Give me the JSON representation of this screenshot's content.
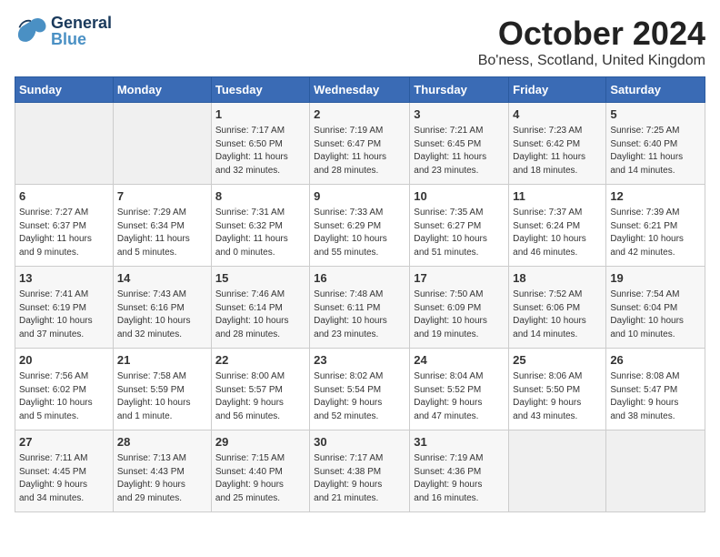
{
  "logo": {
    "general": "General",
    "blue": "Blue"
  },
  "title": "October 2024",
  "subtitle": "Bo'ness, Scotland, United Kingdom",
  "days_of_week": [
    "Sunday",
    "Monday",
    "Tuesday",
    "Wednesday",
    "Thursday",
    "Friday",
    "Saturday"
  ],
  "weeks": [
    [
      {
        "day": "",
        "info": ""
      },
      {
        "day": "",
        "info": ""
      },
      {
        "day": "1",
        "info": "Sunrise: 7:17 AM\nSunset: 6:50 PM\nDaylight: 11 hours\nand 32 minutes."
      },
      {
        "day": "2",
        "info": "Sunrise: 7:19 AM\nSunset: 6:47 PM\nDaylight: 11 hours\nand 28 minutes."
      },
      {
        "day": "3",
        "info": "Sunrise: 7:21 AM\nSunset: 6:45 PM\nDaylight: 11 hours\nand 23 minutes."
      },
      {
        "day": "4",
        "info": "Sunrise: 7:23 AM\nSunset: 6:42 PM\nDaylight: 11 hours\nand 18 minutes."
      },
      {
        "day": "5",
        "info": "Sunrise: 7:25 AM\nSunset: 6:40 PM\nDaylight: 11 hours\nand 14 minutes."
      }
    ],
    [
      {
        "day": "6",
        "info": "Sunrise: 7:27 AM\nSunset: 6:37 PM\nDaylight: 11 hours\nand 9 minutes."
      },
      {
        "day": "7",
        "info": "Sunrise: 7:29 AM\nSunset: 6:34 PM\nDaylight: 11 hours\nand 5 minutes."
      },
      {
        "day": "8",
        "info": "Sunrise: 7:31 AM\nSunset: 6:32 PM\nDaylight: 11 hours\nand 0 minutes."
      },
      {
        "day": "9",
        "info": "Sunrise: 7:33 AM\nSunset: 6:29 PM\nDaylight: 10 hours\nand 55 minutes."
      },
      {
        "day": "10",
        "info": "Sunrise: 7:35 AM\nSunset: 6:27 PM\nDaylight: 10 hours\nand 51 minutes."
      },
      {
        "day": "11",
        "info": "Sunrise: 7:37 AM\nSunset: 6:24 PM\nDaylight: 10 hours\nand 46 minutes."
      },
      {
        "day": "12",
        "info": "Sunrise: 7:39 AM\nSunset: 6:21 PM\nDaylight: 10 hours\nand 42 minutes."
      }
    ],
    [
      {
        "day": "13",
        "info": "Sunrise: 7:41 AM\nSunset: 6:19 PM\nDaylight: 10 hours\nand 37 minutes."
      },
      {
        "day": "14",
        "info": "Sunrise: 7:43 AM\nSunset: 6:16 PM\nDaylight: 10 hours\nand 32 minutes."
      },
      {
        "day": "15",
        "info": "Sunrise: 7:46 AM\nSunset: 6:14 PM\nDaylight: 10 hours\nand 28 minutes."
      },
      {
        "day": "16",
        "info": "Sunrise: 7:48 AM\nSunset: 6:11 PM\nDaylight: 10 hours\nand 23 minutes."
      },
      {
        "day": "17",
        "info": "Sunrise: 7:50 AM\nSunset: 6:09 PM\nDaylight: 10 hours\nand 19 minutes."
      },
      {
        "day": "18",
        "info": "Sunrise: 7:52 AM\nSunset: 6:06 PM\nDaylight: 10 hours\nand 14 minutes."
      },
      {
        "day": "19",
        "info": "Sunrise: 7:54 AM\nSunset: 6:04 PM\nDaylight: 10 hours\nand 10 minutes."
      }
    ],
    [
      {
        "day": "20",
        "info": "Sunrise: 7:56 AM\nSunset: 6:02 PM\nDaylight: 10 hours\nand 5 minutes."
      },
      {
        "day": "21",
        "info": "Sunrise: 7:58 AM\nSunset: 5:59 PM\nDaylight: 10 hours\nand 1 minute."
      },
      {
        "day": "22",
        "info": "Sunrise: 8:00 AM\nSunset: 5:57 PM\nDaylight: 9 hours\nand 56 minutes."
      },
      {
        "day": "23",
        "info": "Sunrise: 8:02 AM\nSunset: 5:54 PM\nDaylight: 9 hours\nand 52 minutes."
      },
      {
        "day": "24",
        "info": "Sunrise: 8:04 AM\nSunset: 5:52 PM\nDaylight: 9 hours\nand 47 minutes."
      },
      {
        "day": "25",
        "info": "Sunrise: 8:06 AM\nSunset: 5:50 PM\nDaylight: 9 hours\nand 43 minutes."
      },
      {
        "day": "26",
        "info": "Sunrise: 8:08 AM\nSunset: 5:47 PM\nDaylight: 9 hours\nand 38 minutes."
      }
    ],
    [
      {
        "day": "27",
        "info": "Sunrise: 7:11 AM\nSunset: 4:45 PM\nDaylight: 9 hours\nand 34 minutes."
      },
      {
        "day": "28",
        "info": "Sunrise: 7:13 AM\nSunset: 4:43 PM\nDaylight: 9 hours\nand 29 minutes."
      },
      {
        "day": "29",
        "info": "Sunrise: 7:15 AM\nSunset: 4:40 PM\nDaylight: 9 hours\nand 25 minutes."
      },
      {
        "day": "30",
        "info": "Sunrise: 7:17 AM\nSunset: 4:38 PM\nDaylight: 9 hours\nand 21 minutes."
      },
      {
        "day": "31",
        "info": "Sunrise: 7:19 AM\nSunset: 4:36 PM\nDaylight: 9 hours\nand 16 minutes."
      },
      {
        "day": "",
        "info": ""
      },
      {
        "day": "",
        "info": ""
      }
    ]
  ]
}
